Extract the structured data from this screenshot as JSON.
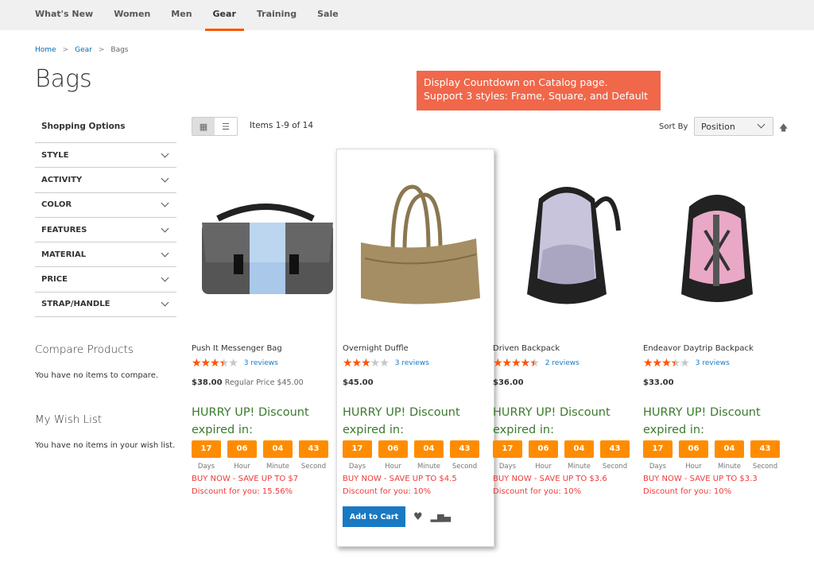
{
  "nav": [
    "What's New",
    "Women",
    "Men",
    "Gear",
    "Training",
    "Sale"
  ],
  "nav_active": "Gear",
  "breadcrumb": [
    "Home",
    "Gear",
    "Bags"
  ],
  "page_title": "Bags",
  "promo": {
    "line1": "Display Countdown on Catalog page.",
    "line2": "Support 3 styles: Frame, Square, and Default",
    "color": "#f0674a"
  },
  "sidebar": {
    "title": "Shopping Options",
    "filters": [
      "STYLE",
      "ACTIVITY",
      "COLOR",
      "FEATURES",
      "MATERIAL",
      "PRICE",
      "STRAP/HANDLE"
    ],
    "compare_title": "Compare Products",
    "compare_text": "You have no items to compare.",
    "wish_title": "My Wish List",
    "wish_text": "You have no items in your wish list."
  },
  "toolbar": {
    "items": "Items 1-9 of 14",
    "sort_label": "Sort By",
    "sort_value": "Position"
  },
  "countdown_labels": [
    "Days",
    "Hour",
    "Minute",
    "Second"
  ],
  "countdown_values": [
    "17",
    "06",
    "04",
    "43"
  ],
  "hurry": "HURRY UP! Discount expired in:",
  "add_to_cart": "Add to Cart",
  "products": [
    {
      "name": "Push It Messenger Bag",
      "rating": 3.5,
      "reviews": "3 reviews",
      "price": "$38.00",
      "regular_label": "Regular Price",
      "regular": "$45.00",
      "save": "BUY NOW - SAVE UP TO $7",
      "discount": "Discount for you: 15.56%"
    },
    {
      "name": "Overnight Duffle",
      "rating": 3,
      "reviews": "3 reviews",
      "price": "$45.00",
      "save": "BUY NOW - SAVE UP TO $4.5",
      "discount": "Discount for you: 10%"
    },
    {
      "name": "Driven Backpack",
      "rating": 4.5,
      "reviews": "2 reviews",
      "price": "$36.00",
      "save": "BUY NOW - SAVE UP TO $3.6",
      "discount": "Discount for you: 10%"
    },
    {
      "name": "Endeavor Daytrip Backpack",
      "rating": 3.5,
      "reviews": "3 reviews",
      "price": "$33.00",
      "save": "BUY NOW - SAVE UP TO $3.3",
      "discount": "Discount for you: 10%"
    }
  ],
  "colors": {
    "accent": "#ff5501",
    "countdown": "#ff8c00",
    "hurry": "#3a7a2d",
    "save": "#f03a3a",
    "button": "#1979c3"
  }
}
